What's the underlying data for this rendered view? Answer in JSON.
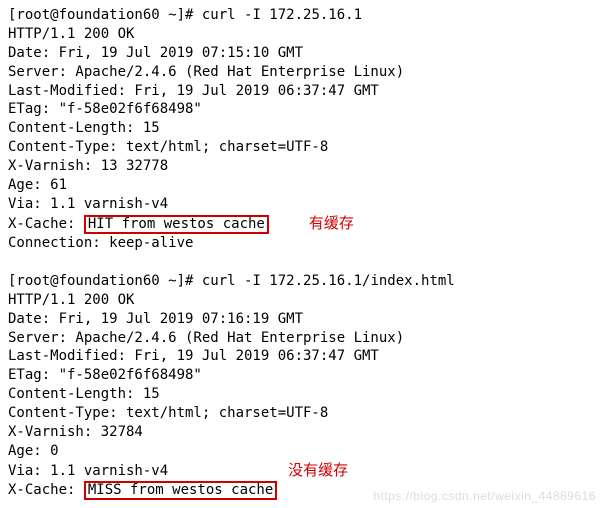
{
  "request1": {
    "prompt": "[root@foundation60 ~]# ",
    "cmd": "curl -I 172.25.16.1",
    "lines": [
      "HTTP/1.1 200 OK",
      "Date: Fri, 19 Jul 2019 07:15:10 GMT",
      "Server: Apache/2.4.6 (Red Hat Enterprise Linux)",
      "Last-Modified: Fri, 19 Jul 2019 06:37:47 GMT",
      "ETag: \"f-58e02f6f68498\"",
      "Content-Length: 15",
      "Content-Type: text/html; charset=UTF-8",
      "X-Varnish: 13 32778",
      "Age: 61",
      "Via: 1.1 varnish-v4"
    ],
    "xcache_label": "X-Cache: ",
    "xcache_value": "HIT from westos cache",
    "annotation": "有缓存",
    "trailer": "Connection: keep-alive"
  },
  "request2": {
    "prompt": "[root@foundation60 ~]# ",
    "cmd": "curl -I 172.25.16.1/index.html",
    "lines": [
      "HTTP/1.1 200 OK",
      "Date: Fri, 19 Jul 2019 07:16:19 GMT",
      "Server: Apache/2.4.6 (Red Hat Enterprise Linux)",
      "Last-Modified: Fri, 19 Jul 2019 06:37:47 GMT",
      "ETag: \"f-58e02f6f68498\"",
      "Content-Length: 15",
      "Content-Type: text/html; charset=UTF-8",
      "X-Varnish: 32784",
      "Age: 0"
    ],
    "via_label": "Via: 1.1 varnish-v4",
    "annotation2": "没有缓存",
    "xcache_label": "X-Cache: ",
    "xcache_value": "MISS from westos cache"
  },
  "watermark": "https://blog.csdn.net/weixin_44889616"
}
